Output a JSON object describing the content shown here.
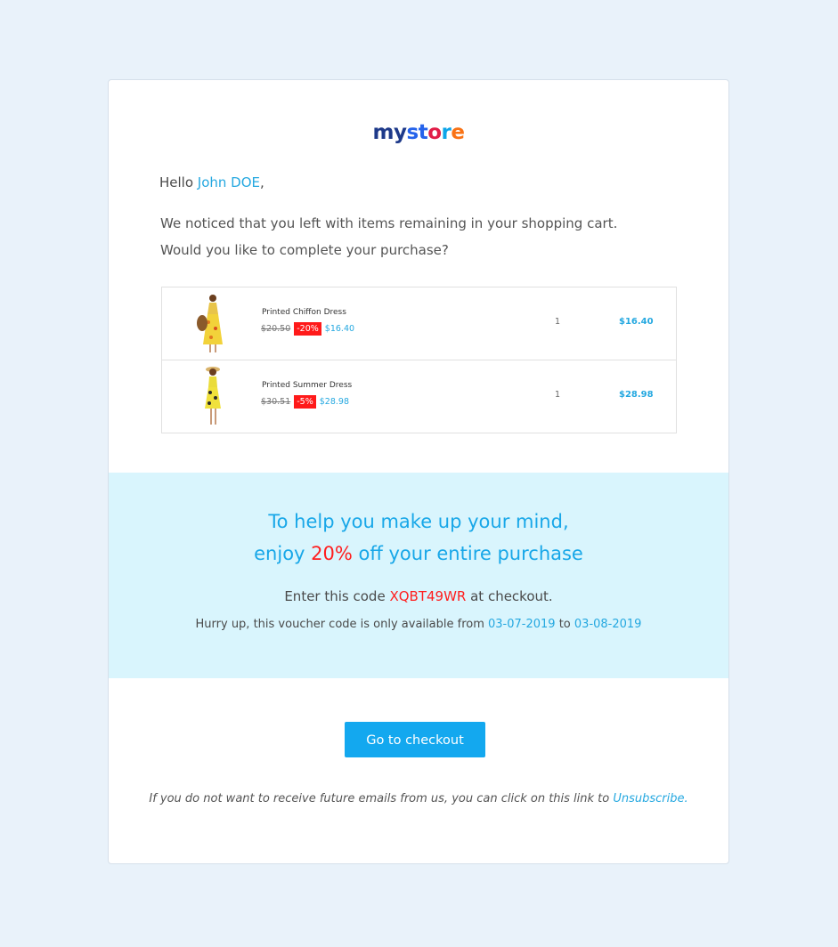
{
  "logo": {
    "part1": "my",
    "part2": "st",
    "part3": "o",
    "part4": "r",
    "part5": "e"
  },
  "greeting": {
    "prefix": "Hello ",
    "name": "John DOE",
    "suffix": ","
  },
  "intro": {
    "line1": "We noticed that you left with items remaining in your shopping cart.",
    "line2": "Would you like to complete your purchase?"
  },
  "cart": {
    "items": [
      {
        "name": "Printed Chiffon Dress",
        "old_price": "$20.50",
        "discount": "-20%",
        "price": "$16.40",
        "qty": "1",
        "total": "$16.40"
      },
      {
        "name": "Printed Summer Dress",
        "old_price": "$30.51",
        "discount": "-5%",
        "price": "$28.98",
        "qty": "1",
        "total": "$28.98"
      }
    ]
  },
  "promo": {
    "line1": "To help you make up your mind,",
    "line2_prefix": "enjoy ",
    "line2_pct": "20%",
    "line2_suffix": " off your entire purchase",
    "code_prefix": "Enter this code ",
    "code": "XQBT49WR",
    "code_suffix": " at checkout.",
    "validity_prefix": "Hurry up, this voucher code is only available from ",
    "date_from": "03-07-2019",
    "validity_mid": " to ",
    "date_to": "03-08-2019"
  },
  "checkout_button": "Go to checkout",
  "footer": {
    "text": "If you do not want to receive future emails from us, you can click on this link to ",
    "unsubscribe": "Unsubscribe."
  },
  "colors": {
    "accent": "#25a8e0",
    "button": "#13a8ef",
    "highlight": "#ff1f1f",
    "promo_bg": "#d9f5fd",
    "page_bg": "#e9f2fa"
  }
}
